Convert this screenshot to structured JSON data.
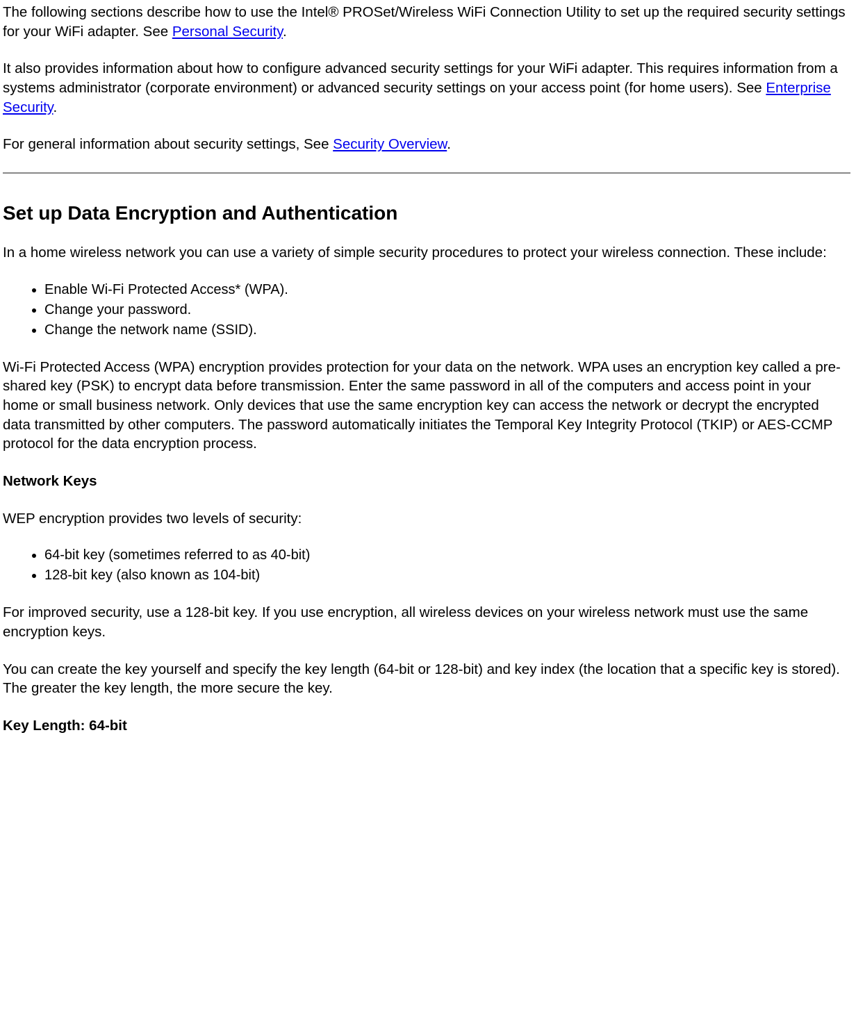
{
  "para1_pre": "The following sections describe how to use the Intel® PROSet/Wireless WiFi Connection Utility to set up the required security settings for your WiFi adapter. See ",
  "link_personal": "Personal Security",
  "para1_post": ".",
  "para2_pre": "It also provides information about how to configure advanced security settings for your WiFi adapter. This requires information from a systems administrator (corporate environment) or advanced security settings on your access point (for home users). See ",
  "link_enterprise": "Enterprise Security",
  "para2_post": ".",
  "para3_pre": "For general information about security settings, See ",
  "link_overview": "Security Overview",
  "para3_post": ".",
  "heading_main": "Set up Data Encryption and Authentication",
  "para4": "In a home wireless network you can use a variety of simple security procedures to protect your wireless connection. These include:",
  "list1": {
    "i0": "Enable Wi-Fi Protected Access* (WPA).",
    "i1": "Change your password.",
    "i2": "Change the network name (SSID)."
  },
  "para5": "Wi-Fi Protected Access (WPA) encryption provides protection for your data on the network. WPA uses an encryption key called a pre-shared key (PSK) to encrypt data before transmission. Enter the same password in all of the computers and access point in your home or small business network. Only devices that use the same encryption key can access the network or decrypt the encrypted data transmitted by other computers. The password automatically initiates the Temporal Key Integrity Protocol (TKIP) or AES-CCMP protocol for the data encryption process.",
  "heading_netkeys": "Network Keys",
  "para6": "WEP encryption provides two levels of security:",
  "list2": {
    "i0": "64-bit key (sometimes referred to as 40-bit)",
    "i1": "128-bit key (also known as 104-bit)"
  },
  "para7": "For improved security, use a 128-bit key. If you use encryption, all wireless devices on your wireless network must use the same encryption keys.",
  "para8": "You can create the key yourself and specify the key length (64-bit or 128-bit) and key index (the location that a specific key is stored). The greater the key length, the more secure the key.",
  "heading_keylen": "Key Length: 64-bit"
}
